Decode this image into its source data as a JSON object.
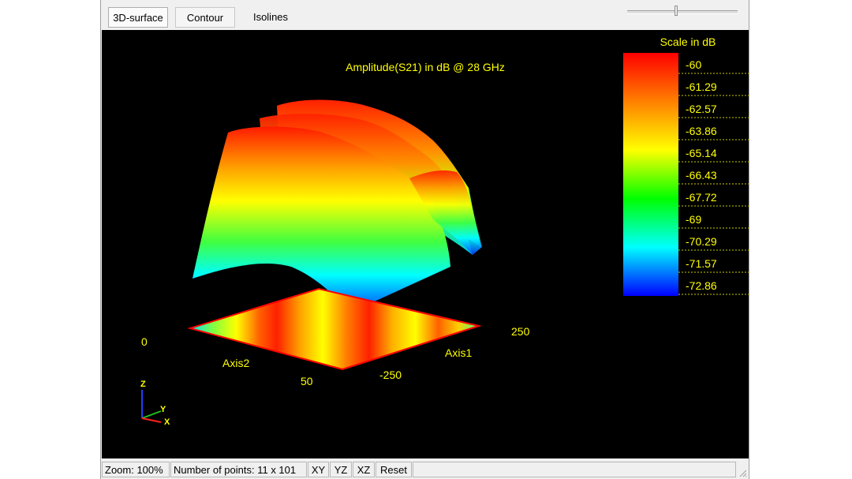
{
  "tabs": [
    {
      "label": "3D-surface",
      "state": "selected"
    },
    {
      "label": "Contour",
      "state": "normal"
    },
    {
      "label": "Isolines",
      "state": "normal"
    }
  ],
  "plot": {
    "title": "Amplitude(S21) in dB @ 28 GHz",
    "axis1_label": "Axis1",
    "axis2_label": "Axis2",
    "axis1_ticks": [
      "250",
      "-250"
    ],
    "axis2_ticks": [
      "0",
      "50"
    ],
    "triad": {
      "z": "Z",
      "y": "Y",
      "x": "X"
    },
    "text_color": "#ffff00",
    "background": "#000000"
  },
  "scale": {
    "title": "Scale in dB",
    "labels": [
      "-60",
      "-61.29",
      "-62.57",
      "-63.86",
      "-65.14",
      "-66.43",
      "-67.72",
      "-69",
      "-70.29",
      "-71.57",
      "-72.86"
    ],
    "colormap": [
      "#ff0000",
      "#ff8000",
      "#ffff00",
      "#00ff00",
      "#00ffff",
      "#0000ff"
    ]
  },
  "status": {
    "zoom": "Zoom: 100%",
    "points": "Number of points: 11 x 101",
    "xy": "XY",
    "yz": "YZ",
    "xz": "XZ",
    "reset": "Reset"
  }
}
